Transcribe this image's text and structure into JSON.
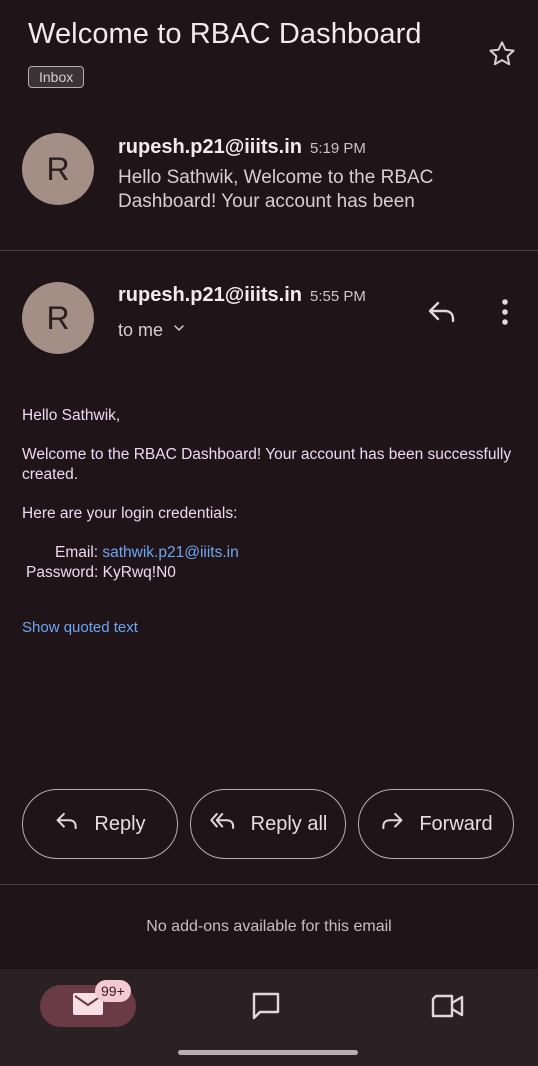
{
  "email": {
    "subject": "Welcome to RBAC Dashboard",
    "label": "Inbox"
  },
  "messages": [
    {
      "avatar_letter": "R",
      "sender": "rupesh.p21@iiits.in",
      "time": "5:19 PM",
      "snippet": "Hello Sathwik, Welcome to the RBAC Dashboard! Your account has been"
    },
    {
      "avatar_letter": "R",
      "sender": "rupesh.p21@iiits.in",
      "time": "5:55 PM",
      "recipient": "to me",
      "body": {
        "greeting": "Hello Sathwik,",
        "line1": "Welcome to the RBAC Dashboard! Your account has been successfully created.",
        "line2": "Here are your login credentials:",
        "email_label": "Email: ",
        "email_value": "sathwik.p21@iiits.in",
        "password_line": "Password: KyRwq!N0"
      },
      "show_quoted": "Show quoted text"
    }
  ],
  "actions": {
    "reply": "Reply",
    "reply_all": "Reply all",
    "forward": "Forward"
  },
  "addons_text": "No add-ons available for this email",
  "nav": {
    "mail_badge": "99+"
  },
  "icons": {
    "star": "star-outline-icon",
    "reply": "reply-arrow-icon",
    "more": "more-vert-icon",
    "chevron": "chevron-down-icon",
    "mail": "mail-icon",
    "chat": "chat-icon",
    "meet": "video-camera-icon"
  },
  "colors": {
    "background": "#1f1418",
    "link": "#6fa6f2",
    "avatar": "#a48f86",
    "nav_active": "#6a3b45"
  }
}
